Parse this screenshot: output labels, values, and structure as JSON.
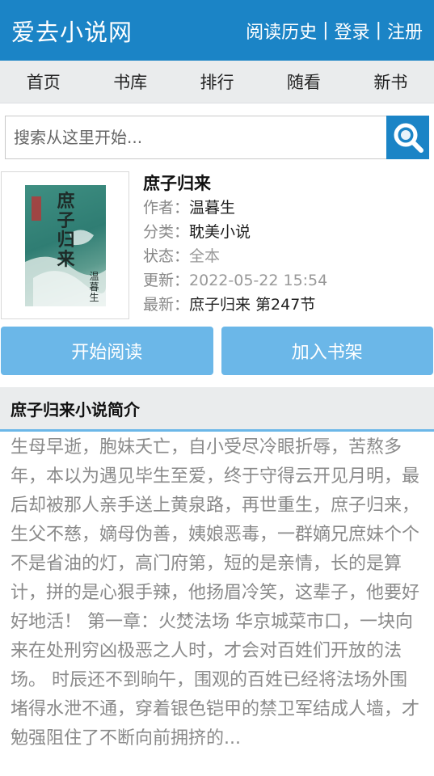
{
  "header": {
    "logo": "爱去小说网",
    "links": [
      "阅读历史",
      "登录",
      "注册"
    ],
    "separator": "|"
  },
  "nav": [
    "首页",
    "书库",
    "排行",
    "随看",
    "新书"
  ],
  "search": {
    "placeholder": "搜索从这里开始...",
    "icon": "search-icon"
  },
  "book": {
    "title": "庶子归来",
    "author_label": "作者：",
    "author": "温暮生",
    "category_label": "分类：",
    "category": "耽美小说",
    "status_label": "状态：",
    "status": "全本",
    "updated_label": "更新：",
    "updated": "2022-05-22 15:54",
    "latest_label": "最新：",
    "latest": "庶子归来 第247节",
    "cover_title": "庶子归来",
    "cover_author": "温暮生"
  },
  "actions": {
    "read": "开始阅读",
    "shelf": "加入书架"
  },
  "intro": {
    "heading": "庶子归来小说简介",
    "text": "生母早逝，胞妹夭亡，自小受尽冷眼折辱，苦熬多年，本以为遇见毕生至爱，终于守得云开见月明，最后却被那人亲手送上黄泉路，再世重生，庶子归来，生父不慈，嫡母伪善，姨娘恶毒，一群嫡兄庶妹个个不是省油的灯，高门府第，短的是亲情，长的是算计，拼的是心狠手辣，他扬眉冷笑，这辈子，他要好好地活！ 第一章：火焚法场 华京城菜市口，一块向来在处刑穷凶极恶之人时，才会对百姓们开放的法场。 时辰还不到晌午，围观的百姓已经将法场外围堵得水泄不通，穿着银色铠甲的禁卫军结成人墙，才勉强阻住了不断向前拥挤的..."
  },
  "colors": {
    "primary": "#1b84c6",
    "button": "#6bb7e8",
    "nav_bg": "#eaeced"
  }
}
